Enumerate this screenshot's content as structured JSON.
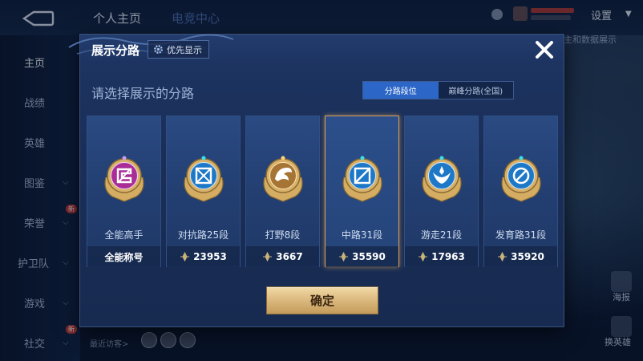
{
  "background": {
    "top_tabs": [
      "个人主页",
      "电竞中心"
    ],
    "settings_label": "设置",
    "side_nav": [
      {
        "label": "主页",
        "active": true,
        "has_caret": false,
        "is_new": false
      },
      {
        "label": "战绩",
        "active": false,
        "has_caret": false,
        "is_new": false
      },
      {
        "label": "英雄",
        "active": false,
        "has_caret": false,
        "is_new": false
      },
      {
        "label": "图鉴",
        "active": false,
        "has_caret": true,
        "is_new": false
      },
      {
        "label": "荣誉",
        "active": false,
        "has_caret": true,
        "is_new": true
      },
      {
        "label": "护卫队",
        "active": false,
        "has_caret": true,
        "is_new": false
      },
      {
        "label": "游戏",
        "active": false,
        "has_caret": true,
        "is_new": false
      },
      {
        "label": "社交",
        "active": false,
        "has_caret": true,
        "is_new": true
      }
    ],
    "new_badge": "新",
    "right_note": "主和数据展示",
    "right_icons": [
      {
        "icon": "poster-icon",
        "label": "海报"
      },
      {
        "icon": "swap-hero-icon",
        "label": "换英雄"
      }
    ],
    "recent_visitors_label": "最近访客>"
  },
  "dialog": {
    "title": "展示分路",
    "priority_button": "优先显示",
    "subtitle": "请选择展示的分路",
    "segments": [
      {
        "label": "分路段位",
        "active": true
      },
      {
        "label": "巅峰分路(全国)",
        "active": false
      }
    ],
    "cards": [
      {
        "lane": "全能高手",
        "footer": "全能称号",
        "score": null,
        "emblem": "allround-emblem-icon",
        "selected": false
      },
      {
        "lane": "对抗路25段",
        "footer": "23953",
        "score": 23953,
        "emblem": "clash-lane-emblem-icon",
        "selected": false
      },
      {
        "lane": "打野8段",
        "footer": "3667",
        "score": 3667,
        "emblem": "jungle-emblem-icon",
        "selected": false
      },
      {
        "lane": "中路31段",
        "footer": "35590",
        "score": 35590,
        "emblem": "mid-lane-emblem-icon",
        "selected": true
      },
      {
        "lane": "游走21段",
        "footer": "17963",
        "score": 17963,
        "emblem": "roam-emblem-icon",
        "selected": false
      },
      {
        "lane": "发育路31段",
        "footer": "35920",
        "score": 35920,
        "emblem": "farm-lane-emblem-icon",
        "selected": false
      }
    ],
    "confirm_label": "确定"
  },
  "colors": {
    "accent_blue": "#2c66c6",
    "gold_button": "#d9b57a",
    "selected_border": "#d7a25d",
    "dialog_bg": "#1e3563"
  }
}
